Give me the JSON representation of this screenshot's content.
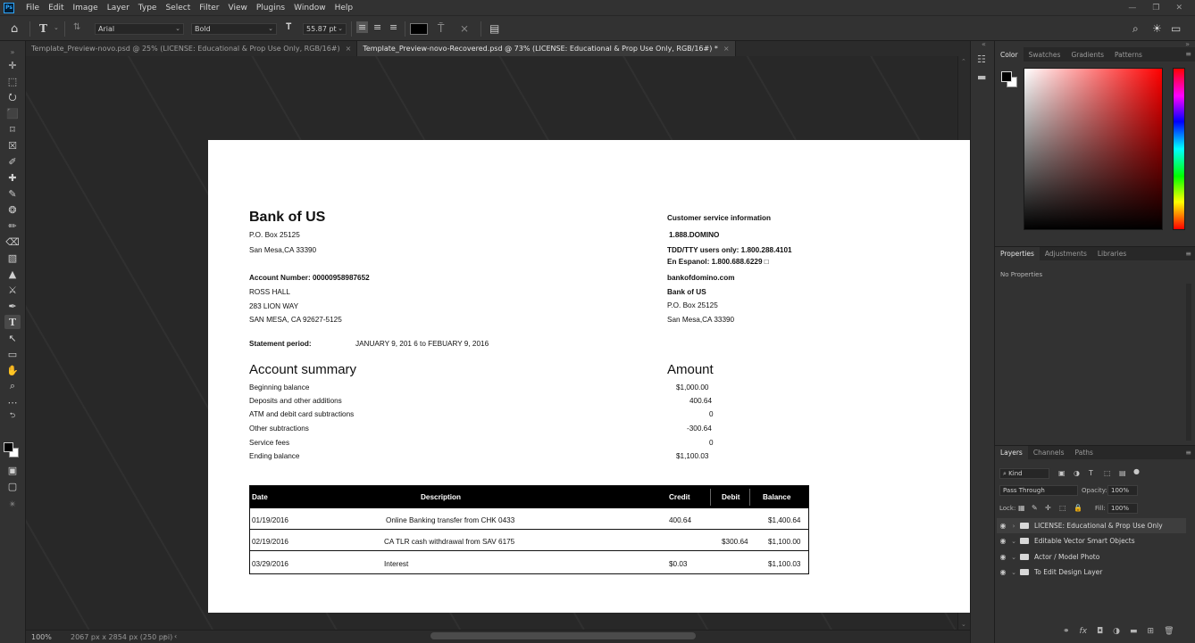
{
  "menubar": {
    "logo": "Ps",
    "items": [
      "File",
      "Edit",
      "Image",
      "Layer",
      "Type",
      "Select",
      "Filter",
      "View",
      "Plugins",
      "Window",
      "Help"
    ]
  },
  "options_bar": {
    "font_family": "Arial",
    "font_style": "Bold",
    "font_size": "55.87 pt",
    "text_color": "#000000"
  },
  "tabs": [
    {
      "label": "Template_Preview-novo.psd @ 25% (LICENSE: Educational & Prop Use Only, RGB/16#)",
      "active": false
    },
    {
      "label": "Template_Preview-novo-Recovered.psd @ 73% (LICENSE: Educational & Prop Use Only, RGB/16#) *",
      "active": true
    }
  ],
  "statusbar": {
    "zoom": "100%",
    "doc_info": "2067 px x 2854 px (250 ppi)"
  },
  "document": {
    "bank_name": "Bank of US",
    "address_line1": "P.O. Box 25125",
    "address_line2": "San Mesa,CA 33390",
    "account_number": "Account Number: 00000958987652",
    "customer_name": "ROSS HALL",
    "customer_street": "283 LION WAY",
    "customer_city": "SAN MESA, CA 92627-5125",
    "statement_label": "Statement period:",
    "statement_period": "JANUARY 9, 201 6 to FEBUARY 9, 2016",
    "cs_title": "Customer service information",
    "cs_phone": "1.888.DOMINO",
    "cs_tdd": "TDD/TTY users only: 1.800.288.4101",
    "cs_espanol": "En Espanol: 1.800.688.6229 □",
    "cs_website": "bankofdomino.com",
    "cs_bank": "Bank of US",
    "cs_addr1": "P.O. Box 25125",
    "cs_addr2": "San Mesa,CA 33390",
    "summary_title": "Account summary",
    "amount_title": "Amount",
    "summary_rows": [
      {
        "label": "Beginning balance",
        "amount": "$1,000.00"
      },
      {
        "label": "Deposits and other additions",
        "amount": "400.64"
      },
      {
        "label": "ATM and debit card subtractions",
        "amount": "0"
      },
      {
        "label": "Other subtractions",
        "amount": "-300.64"
      },
      {
        "label": "Service fees",
        "amount": "0"
      },
      {
        "label": "Ending balance",
        "amount": "$1,100.03"
      }
    ],
    "table": {
      "headers": {
        "date": "Date",
        "description": "Description",
        "credit": "Credit",
        "debit": "Debit",
        "balance": "Balance"
      },
      "rows": [
        {
          "date": "01/19/2016",
          "description": "Online Banking transfer from CHK 0433",
          "credit": "400.64",
          "debit": "",
          "balance": "$1,400.64"
        },
        {
          "date": "02/19/2016",
          "description": "CA TLR cash withdrawal from SAV 6175",
          "credit": "",
          "debit": "$300.64",
          "balance": "$1,100.00"
        },
        {
          "date": "03/29/2016",
          "description": "Interest",
          "credit": "$0.03",
          "debit": "",
          "balance": "$1,100.03"
        }
      ]
    }
  },
  "color_panel": {
    "tabs": [
      "Color",
      "Swatches",
      "Gradients",
      "Patterns"
    ],
    "foreground": "#000000",
    "background": "#ffffff"
  },
  "properties_panel": {
    "tabs": [
      "Properties",
      "Adjustments",
      "Libraries"
    ],
    "empty_text": "No Properties"
  },
  "layers_panel": {
    "tabs": [
      "Layers",
      "Channels",
      "Paths"
    ],
    "filter_kind": "Kind",
    "blend_mode": "Pass Through",
    "opacity_label": "Opacity:",
    "opacity_value": "100%",
    "lock_label": "Lock:",
    "fill_label": "Fill:",
    "fill_value": "100%",
    "layers": [
      {
        "name": "LICENSE: Educational & Prop Use Only",
        "active": true
      },
      {
        "name": "Editable Vector Smart Objects",
        "active": false
      },
      {
        "name": "Actor / Model Photo",
        "active": false
      },
      {
        "name": "To Edit Design Layer",
        "active": false
      }
    ]
  }
}
